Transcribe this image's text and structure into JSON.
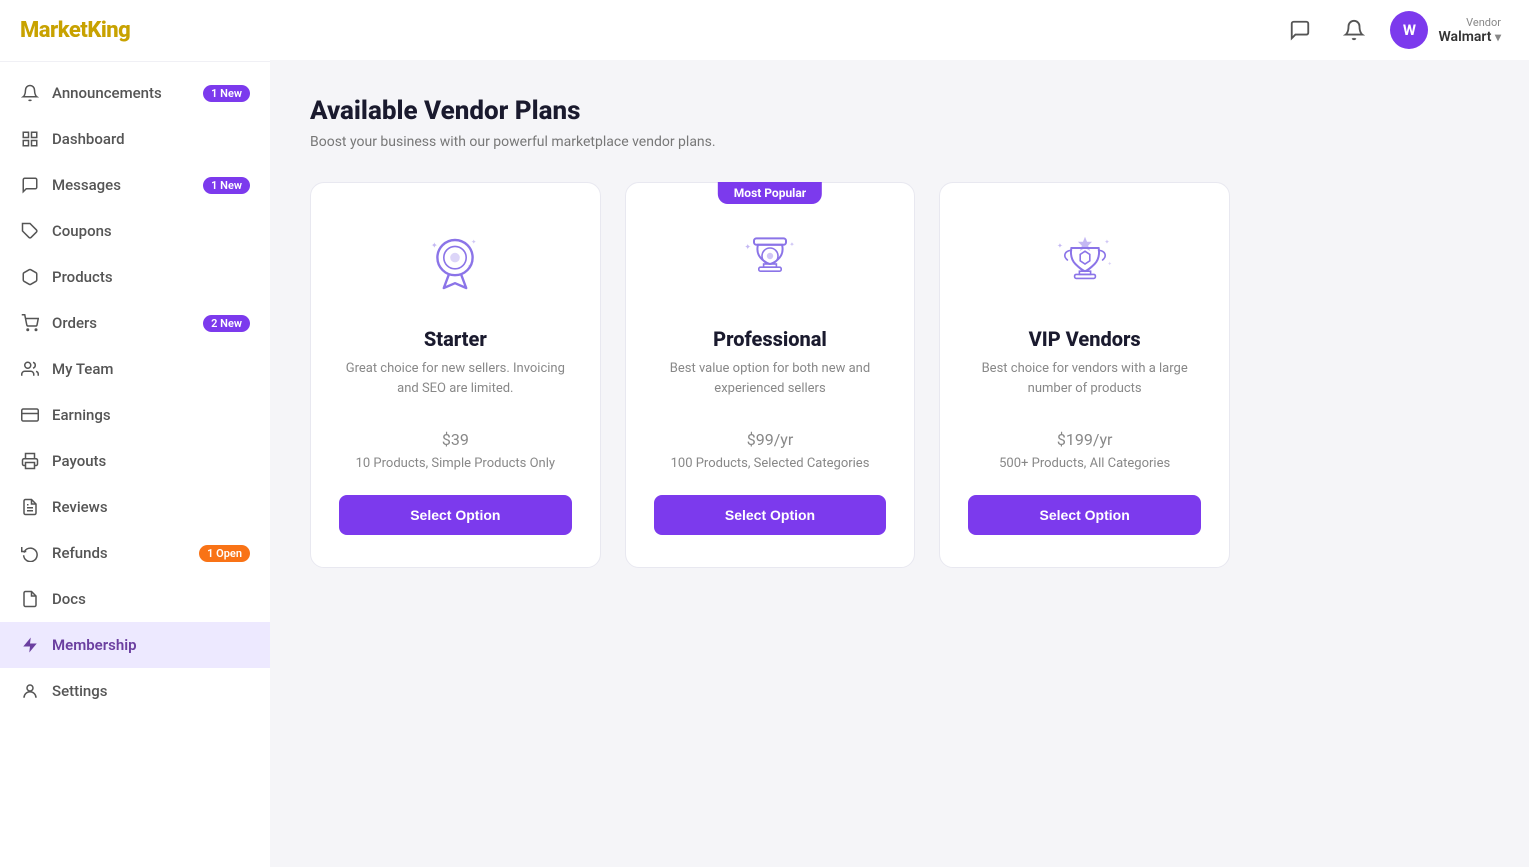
{
  "logo": {
    "text_black": "Market",
    "text_gold": "King"
  },
  "sidebar": {
    "items": [
      {
        "id": "announcements",
        "label": "Announcements",
        "icon": "🔔",
        "badge": "1 New",
        "active": false
      },
      {
        "id": "dashboard",
        "label": "Dashboard",
        "icon": "⊞",
        "badge": null,
        "active": false
      },
      {
        "id": "messages",
        "label": "Messages",
        "icon": "💬",
        "badge": "1 New",
        "active": false
      },
      {
        "id": "coupons",
        "label": "Coupons",
        "icon": "🏷",
        "badge": null,
        "active": false
      },
      {
        "id": "products",
        "label": "Products",
        "icon": "📦",
        "badge": null,
        "active": false
      },
      {
        "id": "orders",
        "label": "Orders",
        "icon": "🛍",
        "badge": "2 New",
        "active": false
      },
      {
        "id": "my-team",
        "label": "My Team",
        "icon": "👥",
        "badge": null,
        "active": false
      },
      {
        "id": "earnings",
        "label": "Earnings",
        "icon": "💳",
        "badge": null,
        "active": false
      },
      {
        "id": "payouts",
        "label": "Payouts",
        "icon": "🖨",
        "badge": null,
        "active": false
      },
      {
        "id": "reviews",
        "label": "Reviews",
        "icon": "📋",
        "badge": null,
        "active": false
      },
      {
        "id": "refunds",
        "label": "Refunds",
        "icon": "↩",
        "badge": "1 Open",
        "active": false
      },
      {
        "id": "docs",
        "label": "Docs",
        "icon": "📄",
        "badge": null,
        "active": false
      },
      {
        "id": "membership",
        "label": "Membership",
        "icon": "➤",
        "badge": null,
        "active": true
      },
      {
        "id": "settings",
        "label": "Settings",
        "icon": "👤",
        "badge": null,
        "active": false
      }
    ]
  },
  "topbar": {
    "chat_icon": "chat",
    "bell_icon": "bell",
    "role": "Vendor",
    "vendor_name": "Walmart",
    "avatar_letter": "W"
  },
  "page": {
    "title": "Available Vendor Plans",
    "subtitle": "Boost your business with our powerful marketplace vendor plans."
  },
  "plans": [
    {
      "id": "starter",
      "name": "Starter",
      "description": "Great choice for new sellers. Invoicing and SEO are limited.",
      "price": "$39",
      "period": "",
      "features": "10 Products, Simple Products Only",
      "button_label": "Select Option",
      "badge": null,
      "icon_type": "medal"
    },
    {
      "id": "professional",
      "name": "Professional",
      "description": "Best value option for both new and experienced sellers",
      "price": "$99",
      "period": "/yr",
      "features": "100 Products, Selected Categories",
      "button_label": "Select Option",
      "badge": "Most Popular",
      "icon_type": "trophy"
    },
    {
      "id": "vip",
      "name": "VIP Vendors",
      "description": "Best choice for vendors with a large number of products",
      "price": "$199",
      "period": "/yr",
      "features": "500+ Products, All Categories",
      "button_label": "Select Option",
      "badge": null,
      "icon_type": "vip-trophy"
    }
  ]
}
